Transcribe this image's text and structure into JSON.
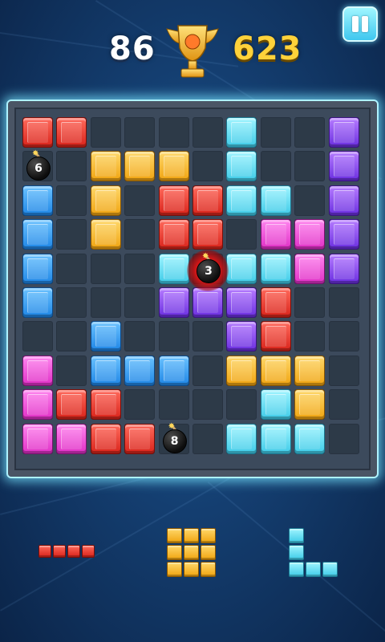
{
  "hud": {
    "current_score": "86",
    "best_score": "623",
    "pause_button": "pause"
  },
  "board": {
    "size": 10,
    "cells": [
      [
        "red",
        "red",
        null,
        null,
        null,
        null,
        "cyan",
        null,
        null,
        "purple"
      ],
      [
        null,
        null,
        "yellow",
        "yellow",
        "yellow",
        null,
        "cyan",
        null,
        null,
        "purple"
      ],
      [
        "blue",
        null,
        "yellow",
        null,
        "red",
        "red",
        "cyan",
        "cyan",
        null,
        "purple"
      ],
      [
        "blue",
        null,
        "yellow",
        null,
        "red",
        "red",
        null,
        "pink",
        "pink",
        "purple"
      ],
      [
        "blue",
        null,
        null,
        null,
        "cyan",
        null,
        "cyan",
        "cyan",
        "pink",
        "purple"
      ],
      [
        "blue",
        null,
        null,
        null,
        "purple",
        "purple",
        "purple",
        "red",
        null,
        null
      ],
      [
        null,
        null,
        "blue",
        null,
        null,
        null,
        "purple",
        "red",
        null,
        null
      ],
      [
        "pink",
        null,
        "blue",
        "blue",
        "blue",
        null,
        "yellow",
        "yellow",
        "yellow",
        null
      ],
      [
        "pink",
        "red",
        "red",
        null,
        null,
        null,
        null,
        "cyan",
        "yellow",
        null
      ],
      [
        "pink",
        "pink",
        "red",
        "red",
        null,
        null,
        "cyan",
        "cyan",
        "cyan",
        null
      ]
    ],
    "bombs": [
      {
        "row": 1,
        "col": 0,
        "count": "6",
        "active": false
      },
      {
        "row": 4,
        "col": 5,
        "count": "3",
        "active": true
      },
      {
        "row": 9,
        "col": 4,
        "count": "8",
        "active": false
      }
    ]
  },
  "tray": [
    {
      "name": "red-i4-horizontal",
      "color": "red",
      "cells": [
        [
          0,
          0
        ],
        [
          1,
          0
        ],
        [
          2,
          0
        ],
        [
          3,
          0
        ]
      ]
    },
    {
      "name": "yellow-3x3-square",
      "color": "yellow",
      "cells": [
        [
          0,
          0
        ],
        [
          1,
          0
        ],
        [
          2,
          0
        ],
        [
          0,
          1
        ],
        [
          1,
          1
        ],
        [
          2,
          1
        ],
        [
          0,
          2
        ],
        [
          1,
          2
        ],
        [
          2,
          2
        ]
      ]
    },
    {
      "name": "cyan-l-shape",
      "color": "cyan",
      "cells": [
        [
          0,
          0
        ],
        [
          0,
          1
        ],
        [
          0,
          2
        ],
        [
          1,
          2
        ],
        [
          2,
          2
        ]
      ]
    }
  ],
  "colors": {
    "red": "#e83a2c",
    "yellow": "#f5b52a",
    "cyan": "#5fdcf0",
    "blue": "#2f97ef",
    "purple": "#8245ea",
    "pink": "#ea4ad3"
  }
}
